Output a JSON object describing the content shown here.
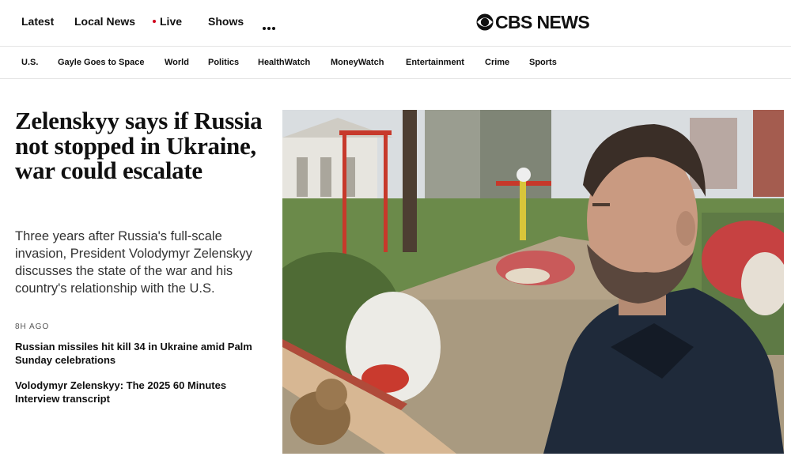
{
  "top_nav": {
    "items": [
      {
        "label": "Latest"
      },
      {
        "label": "Local News"
      },
      {
        "label": "Live"
      },
      {
        "label": "Shows"
      }
    ],
    "more_icon": "ellipsis-icon"
  },
  "logo": {
    "text": "CBS NEWS",
    "icon": "cbs-eye-icon"
  },
  "section_nav": {
    "items": [
      {
        "label": "U.S."
      },
      {
        "label": "Gayle Goes to Space"
      },
      {
        "label": "World"
      },
      {
        "label": "Politics"
      },
      {
        "label": "HealthWatch"
      },
      {
        "label": "MoneyWatch"
      },
      {
        "label": "Entertainment"
      },
      {
        "label": "Crime"
      },
      {
        "label": "Sports"
      }
    ]
  },
  "hero": {
    "headline": "Zelenskyy says if Russia not stopped in Ukraine, war could escalate",
    "dek": "Three years after Russia's full-scale invasion, President Volodymyr Zelenskyy discusses the state of the war and his country's relationship with the U.S.",
    "timestamp": "8H AGO",
    "related": [
      {
        "title": "Russian missiles hit kill 34 in Ukraine amid Palm Sunday celebrations"
      },
      {
        "title": "Volodymyr Zelenskyy: The 2025 60 Minutes Interview transcript"
      }
    ]
  },
  "colors": {
    "text": "#101010",
    "live_dot": "#d0021b",
    "divider": "#e4e4e4"
  }
}
